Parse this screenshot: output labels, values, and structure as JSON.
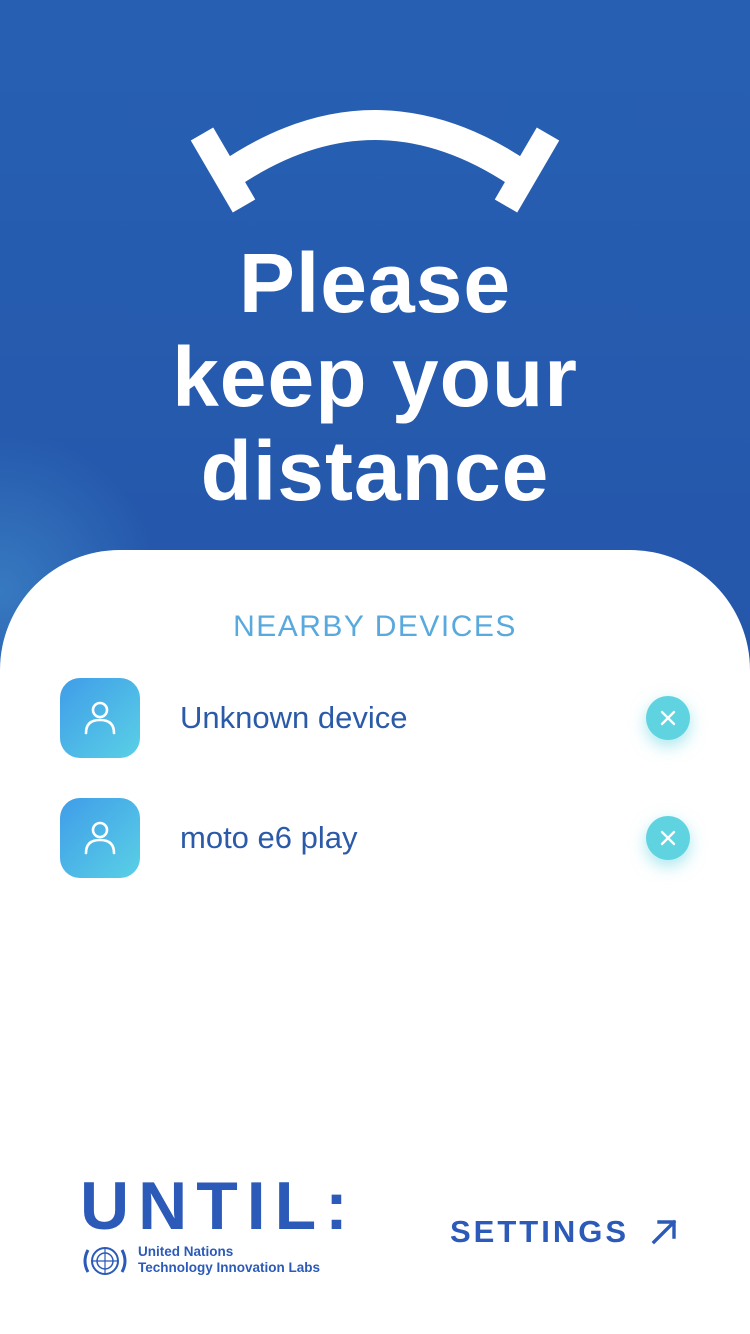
{
  "hero": {
    "icon": "distance-arc-icon",
    "headline_lines": [
      "Please",
      "keep your",
      "distance"
    ]
  },
  "nearby": {
    "title": "NEARBY DEVICES",
    "devices": [
      {
        "name": "Unknown device",
        "avatar_icon": "person-icon",
        "action_icon": "close-icon"
      },
      {
        "name": "moto e6 play",
        "avatar_icon": "person-icon",
        "action_icon": "close-icon"
      }
    ]
  },
  "footer": {
    "brand_word": "UNTIL:",
    "org_line_1": "United Nations",
    "org_line_2": "Technology Innovation Labs",
    "settings_label": "SETTINGS",
    "settings_icon": "arrow-up-right-icon"
  },
  "colors": {
    "background_blue": "#2454a8",
    "accent_cyan": "#5fd3e0",
    "section_title": "#58a9dd",
    "text_blue": "#2b5aa8"
  }
}
